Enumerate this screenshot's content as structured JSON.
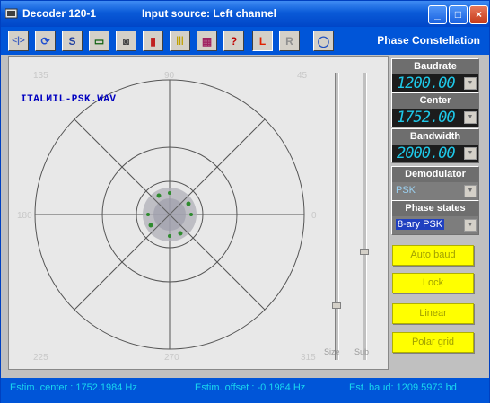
{
  "window": {
    "app_title": "Decoder 120-1",
    "subtitle": "Input source: Left channel",
    "minimize": "_",
    "maximize": "□",
    "close": "×"
  },
  "toolbar": {
    "mode_label": "Phase Constellation",
    "tools": [
      {
        "name": "swap-channels",
        "glyph": "<|>"
      },
      {
        "name": "refresh",
        "glyph": "⟳"
      },
      {
        "name": "sync",
        "glyph": "S"
      },
      {
        "name": "save",
        "glyph": "▭"
      },
      {
        "name": "camera",
        "glyph": "◙"
      },
      {
        "name": "spectrum",
        "glyph": "▮"
      },
      {
        "name": "bars",
        "glyph": "|||"
      },
      {
        "name": "grid",
        "glyph": "▦"
      },
      {
        "name": "help",
        "glyph": "?"
      },
      {
        "name": "left-channel",
        "glyph": "L"
      },
      {
        "name": "right-channel",
        "glyph": "R"
      },
      {
        "name": "stop",
        "glyph": "◯"
      }
    ]
  },
  "plot": {
    "filename": "ITALMIL-PSK.WAV",
    "angle_labels": [
      "135",
      "90",
      "45",
      "180",
      "0",
      "225",
      "270",
      "315"
    ]
  },
  "panel": {
    "baudrate": {
      "label": "Baudrate",
      "value": "1200.00"
    },
    "center": {
      "label": "Center",
      "value": "1752.00"
    },
    "bandwidth": {
      "label": "Bandwidth",
      "value": "2000.00"
    },
    "demodulator": {
      "label": "Demodulator",
      "value": "PSK"
    },
    "phase_states": {
      "label": "Phase states",
      "value": "8-ary PSK"
    },
    "buttons": [
      "Auto baud",
      "Lock",
      "Linear",
      "Polar grid"
    ]
  },
  "sliders": {
    "left_label": "Size",
    "right_label": "Sub"
  },
  "status": {
    "center": "Estim. center :  1752.1984 Hz",
    "offset": "Estim. offset : -0.1984 Hz",
    "baud": "Est. baud:  1209.5973 bd"
  },
  "colors": {
    "titlebar": "#0a5ad8",
    "lcd_text": "#1ec8e8",
    "button_yellow": "#ffff00",
    "status_text": "#18d8f0"
  }
}
